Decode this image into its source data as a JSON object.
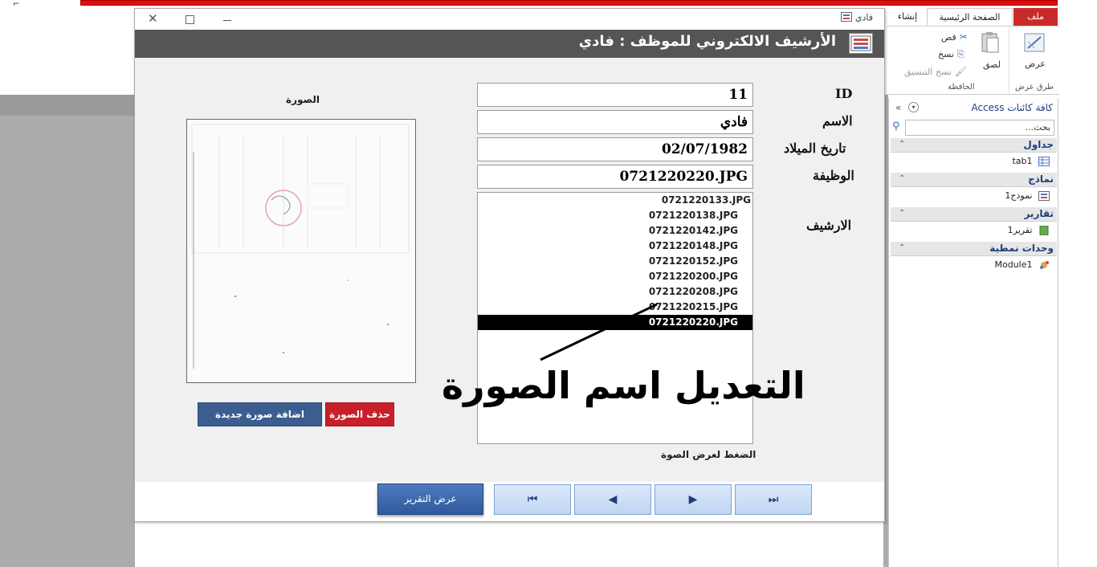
{
  "ribbon": {
    "tabs": {
      "file": "ملف",
      "home": "الصفحة الرئيسية",
      "create": "إنشاء"
    },
    "buttons": {
      "view": "عرض",
      "paste": "لصق",
      "cut": "قص",
      "copy": "نسخ",
      "format_painter": "نسخ التنسيق"
    },
    "groups": {
      "views": "طرق عرض",
      "clipboard": "الحافظة"
    }
  },
  "nav": {
    "title": "كافة كائنات Access",
    "search_placeholder": "بحث...",
    "groups": [
      {
        "label": "جداول",
        "items": [
          "tab1"
        ]
      },
      {
        "label": "نماذج",
        "items": [
          "نموذج1"
        ]
      },
      {
        "label": "تقارير",
        "items": [
          "تقرير1"
        ]
      },
      {
        "label": "وحدات نمطية",
        "items": [
          "Module1"
        ]
      }
    ]
  },
  "window": {
    "tab_title": "فادي"
  },
  "form": {
    "header_title": "الأرشيف الالكتروني للموظف : فادي",
    "labels": {
      "id": "ID",
      "name": "الاسم",
      "dob": "تاريخ الميلاد",
      "job": "الوظيفة",
      "archive": "الارشيف",
      "image": "الصورة"
    },
    "values": {
      "id": "11",
      "name": "فادي",
      "dob": "02/07/1982",
      "job": "0721220220.JPG"
    },
    "archive_items": [
      "0721220133.JPG",
      "0721220138.JPG",
      "0721220142.JPG",
      "0721220148.JPG",
      "0721220152.JPG",
      "0721220200.JPG",
      "0721220208.JPG",
      "0721220215.JPG",
      "0721220220.JPG"
    ],
    "selected_archive": "0721220220.JPG",
    "buttons": {
      "add_image": "اضافة صورة جديدة",
      "delete_image": "حذف الصورة",
      "report": "عرض التقرير"
    },
    "click_hint": "الضغط لعرض الصوة",
    "annotation": "التعديل اسم الصورة"
  },
  "colors": {
    "file_tab": "#c92a2a",
    "form_header": "#555555",
    "delete_btn": "#c8202b",
    "add_btn": "#3b5d8f",
    "nav_group_text": "#1e3f7a"
  },
  "icons": [
    "close-icon",
    "maximize-icon",
    "minimize-icon",
    "form-icon",
    "table-icon",
    "report-icon",
    "module-icon",
    "search-icon",
    "first-record-icon",
    "prev-record-icon",
    "next-record-icon",
    "last-record-icon",
    "cut-icon",
    "copy-icon",
    "paste-icon",
    "format-painter-icon",
    "view-icon"
  ]
}
